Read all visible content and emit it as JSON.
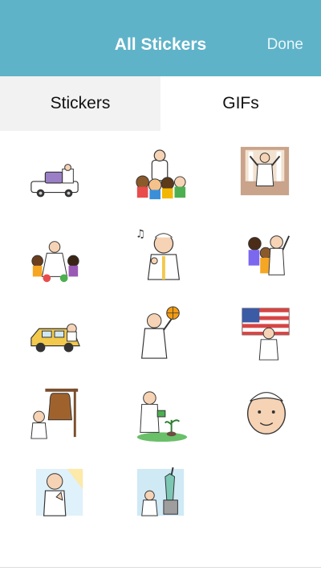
{
  "header": {
    "title": "All Stickers",
    "done_label": "Done",
    "bg_color": "#5fb3c9"
  },
  "tabs": [
    {
      "label": "Stickers",
      "active": false
    },
    {
      "label": "GIFs",
      "active": true
    }
  ],
  "stickers": [
    {
      "icon": "pope-popemobile-sticker-icon"
    },
    {
      "icon": "pope-with-crowd-sticker-icon"
    },
    {
      "icon": "pope-on-stage-sticker-icon"
    },
    {
      "icon": "pope-dancing-sticker-icon"
    },
    {
      "icon": "pope-singing-music-notes-sticker-icon"
    },
    {
      "icon": "pope-selfie-friends-sticker-icon"
    },
    {
      "icon": "pope-taxi-sticker-icon"
    },
    {
      "icon": "pope-basketball-sticker-icon"
    },
    {
      "icon": "pope-american-flag-sticker-icon"
    },
    {
      "icon": "pope-liberty-bell-sticker-icon"
    },
    {
      "icon": "pope-watering-plant-sticker-icon"
    },
    {
      "icon": "pope-face-sticker-icon"
    },
    {
      "icon": "pope-praying-sticker-icon"
    },
    {
      "icon": "pope-statue-of-liberty-sticker-icon"
    }
  ]
}
